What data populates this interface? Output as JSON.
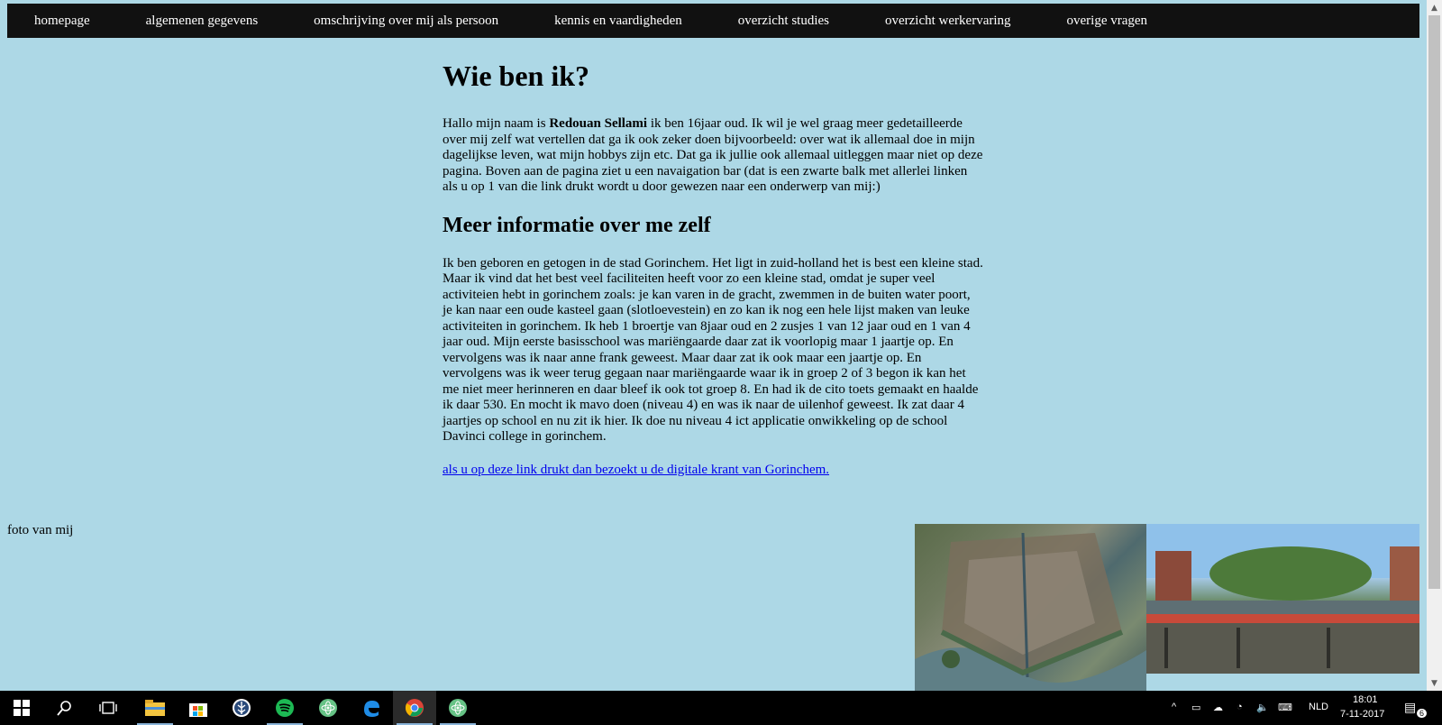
{
  "nav": {
    "items": [
      "homepage",
      "algemenen gegevens",
      "omschrijving over mij als persoon",
      "kennis en vaardigheden",
      "overzicht studies",
      "overzicht werkervaring",
      "overige vragen"
    ]
  },
  "main": {
    "title": "Wie ben ik?",
    "intro_before": "Hallo mijn naam is ",
    "intro_name": "Redouan Sellami",
    "intro_after": " ik ben 16jaar oud. Ik wil je wel graag meer gedetailleerde over mij zelf wat vertellen dat ga ik ook zeker doen bijvoorbeeld: over wat ik allemaal doe in mijn dagelijkse leven, wat mijn hobbys zijn etc. Dat ga ik jullie ook allemaal uitleggen maar niet op deze pagina. Boven aan de pagina ziet u een navaigation bar (dat is een zwarte balk met allerlei linken als u op 1 van die link drukt wordt u door gewezen naar een onderwerp van mij:)",
    "subtitle": "Meer informatie over me zelf",
    "body": "Ik ben geboren en getogen in de stad Gorinchem. Het ligt in zuid-holland het is best een kleine stad. Maar ik vind dat het best veel faciliteiten heeft voor zo een kleine stad, omdat je super veel activiteien hebt in gorinchem zoals: je kan varen in de gracht, zwemmen in de buiten water poort, je kan naar een oude kasteel gaan (slotloevestein) en zo kan ik nog een hele lijst maken van leuke activiteiten in gorinchem. Ik heb 1 broertje van 8jaar oud en 2 zusjes 1 van 12 jaar oud en 1 van 4 jaar oud. Mijn eerste basisschool was mariëngaarde daar zat ik voorlopig maar 1 jaartje op. En vervolgens was ik naar anne frank geweest. Maar daar zat ik ook maar een jaartje op. En vervolgens was ik weer terug gegaan naar mariëngaarde waar ik in groep 2 of 3 begon ik kan het me niet meer herinneren en daar bleef ik ook tot groep 8. En had ik de cito toets gemaakt en haalde ik daar 530. En mocht ik mavo doen (niveau 4) en was ik naar de uilenhof geweest. Ik zat daar 4 jaartjes op school en nu zit ik hier. Ik doe nu niveau 4 ict applicatie onwikkeling op de school Davinci college in gorinchem.",
    "link": "als u op deze link drukt dan bezoekt u de digitale krant van Gorinchem.",
    "photo_label": "foto van mij"
  },
  "taskbar": {
    "language": "NLD",
    "time": "18:01",
    "date": "7-11-2017",
    "notification_count": "6"
  }
}
